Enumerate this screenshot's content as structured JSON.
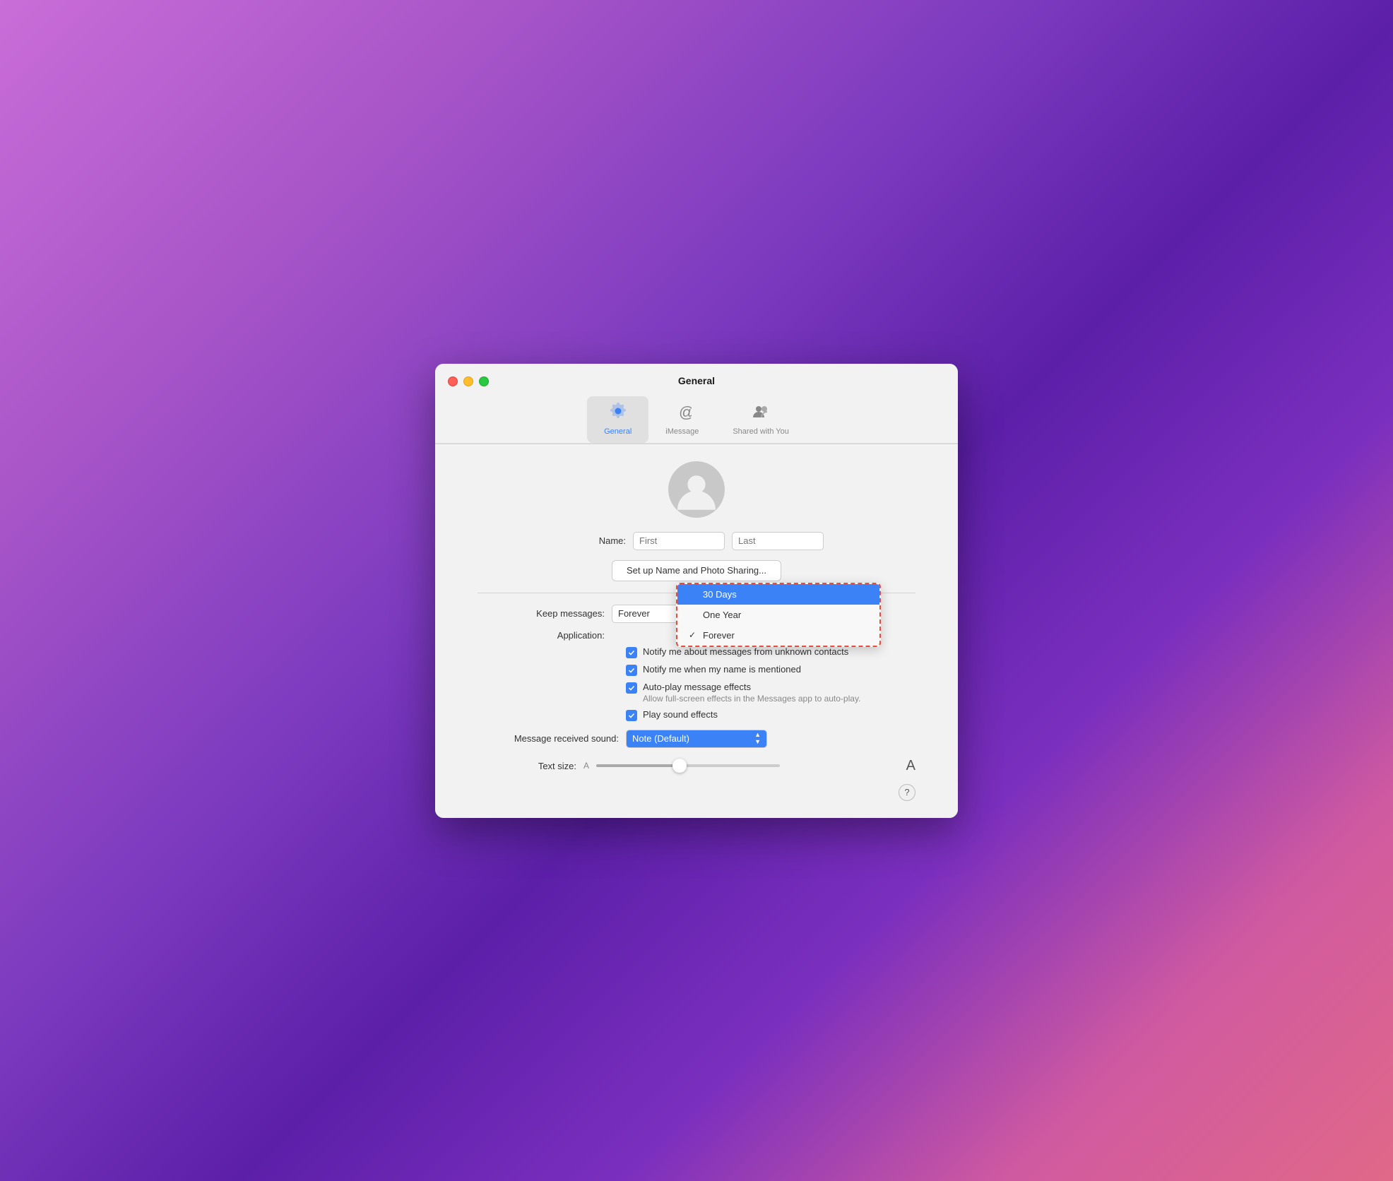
{
  "window": {
    "title": "General"
  },
  "traffic_lights": {
    "close": "close",
    "minimize": "minimize",
    "maximize": "maximize"
  },
  "toolbar": {
    "tabs": [
      {
        "id": "general",
        "label": "General",
        "active": true
      },
      {
        "id": "imessage",
        "label": "iMessage",
        "active": false
      },
      {
        "id": "shared",
        "label": "Shared with You",
        "active": false
      }
    ]
  },
  "name_section": {
    "label": "Name:",
    "first_placeholder": "First",
    "last_placeholder": "Last"
  },
  "setup_button": {
    "label": "Set up Name and Photo Sharing..."
  },
  "dropdown": {
    "items": [
      {
        "id": "30days",
        "label": "30 Days",
        "selected": true,
        "checked": false
      },
      {
        "id": "oneyear",
        "label": "One Year",
        "selected": false,
        "checked": false
      },
      {
        "id": "forever",
        "label": "Forever",
        "selected": false,
        "checked": true
      }
    ]
  },
  "keep_messages": {
    "label": "Keep messages:",
    "current_value": "Forever"
  },
  "application": {
    "label": "Application:"
  },
  "checkboxes": [
    {
      "id": "notify-unknown",
      "label": "Notify me about messages from unknown contacts",
      "checked": true,
      "subtext": ""
    },
    {
      "id": "notify-mentioned",
      "label": "Notify me when my name is mentioned",
      "checked": true,
      "subtext": ""
    },
    {
      "id": "autoplay",
      "label": "Auto-play message effects",
      "checked": true,
      "subtext": "Allow full-screen effects in the Messages app to auto-play."
    },
    {
      "id": "sound-effects",
      "label": "Play sound effects",
      "checked": true,
      "subtext": ""
    }
  ],
  "sound": {
    "label": "Message received sound:",
    "value": "Note (Default)"
  },
  "text_size": {
    "label": "Text size:",
    "small_a": "A",
    "large_a": "A",
    "slider_value": 45
  },
  "help": {
    "label": "?"
  }
}
